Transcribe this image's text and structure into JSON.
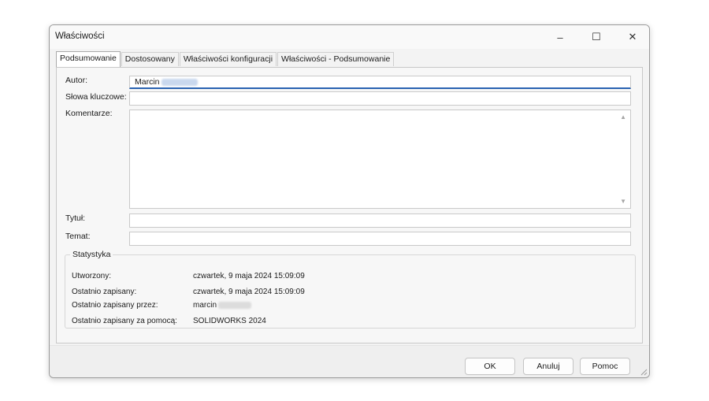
{
  "window": {
    "title": "Właściwości",
    "controls": {
      "minimize": "–",
      "maximize": "☐",
      "close": "✕"
    }
  },
  "tabs": [
    {
      "label": "Podsumowanie",
      "active": true
    },
    {
      "label": "Dostosowany",
      "active": false
    },
    {
      "label": "Właściwości konfiguracji",
      "active": false
    },
    {
      "label": "Właściwości - Podsumowanie",
      "active": false
    }
  ],
  "form": {
    "author_label": "Autor:",
    "author_value": "Marcin",
    "keywords_label": "Słowa kluczowe:",
    "keywords_value": "",
    "comments_label": "Komentarze:",
    "comments_value": "",
    "title_label": "Tytuł:",
    "title_value": "",
    "subject_label": "Temat:",
    "subject_value": ""
  },
  "statistics": {
    "legend": "Statystyka",
    "rows": [
      {
        "label": "Utworzony:",
        "value": "czwartek, 9 maja 2024 15:09:09"
      },
      {
        "label": "Ostatnio zapisany:",
        "value": "czwartek, 9 maja 2024 15:09:09"
      },
      {
        "label": "Ostatnio zapisany przez:",
        "value": "marcin"
      },
      {
        "label": "Ostatnio zapisany za pomocą:",
        "value": "SOLIDWORKS 2024"
      }
    ]
  },
  "buttons": {
    "ok": "OK",
    "cancel": "Anuluj",
    "help": "Pomoc"
  },
  "colors": {
    "focus_underline": "#2a63b2",
    "window_bg": "#f3f3f3"
  }
}
